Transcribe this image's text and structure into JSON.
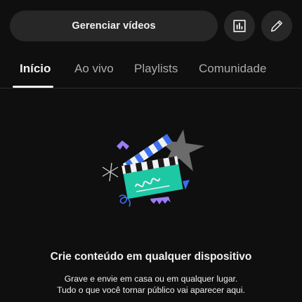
{
  "header": {
    "manage_videos_label": "Gerenciar vídeos",
    "analytics_icon": "bar-chart-icon",
    "edit_icon": "pencil-icon"
  },
  "tabs": [
    {
      "label": "Início",
      "active": true
    },
    {
      "label": "Ao vivo",
      "active": false
    },
    {
      "label": "Playlists",
      "active": false
    },
    {
      "label": "Comunidade",
      "active": false
    }
  ],
  "empty_state": {
    "illustration": "clapperboard-illustration",
    "title": "Crie conteúdo em qualquer dispositivo",
    "line1": "Grave e envie em casa ou em qualquer lugar.",
    "line2": "Tudo o que você tornar público vai aparecer aqui."
  },
  "colors": {
    "background": "#0f0f0f",
    "button_bg": "#272727",
    "text_primary": "#f1f1f1",
    "text_secondary": "#aaaaaa",
    "accent_teal": "#1ec8a5",
    "accent_purple": "#9c7cf4",
    "accent_blue": "#3a6ff0",
    "star_gray": "#6b6b6b"
  }
}
